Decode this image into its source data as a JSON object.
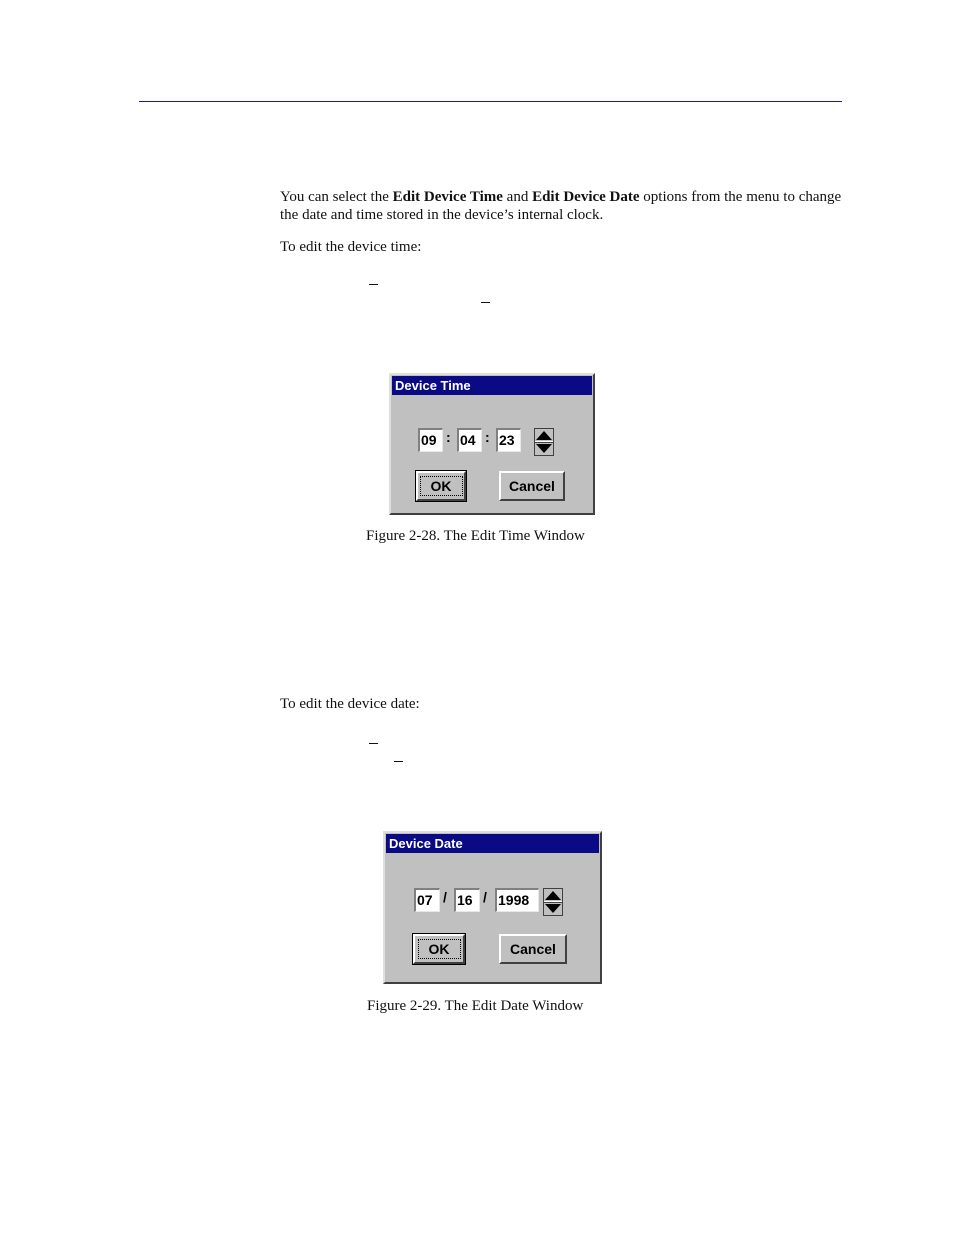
{
  "intro": {
    "text_before": "You can select the ",
    "bold_1": "Edit Device Time",
    "text_mid": " and ",
    "bold_2": "Edit Device Date",
    "text_after": " options from the menu to change the date and time stored in the device’s internal clock."
  },
  "time_steps_intro": "To edit the device time:",
  "date_steps_intro": "To edit the device date:",
  "time_dialog": {
    "title": "Device Time",
    "hours": "09",
    "minutes": "04",
    "seconds": "23",
    "separator": ":",
    "ok_label": "OK",
    "cancel_label": "Cancel",
    "caption": "Figure 2-28.  The Edit Time Window"
  },
  "date_dialog": {
    "title": "Device Date",
    "month": "07",
    "day": "16",
    "year": "1998",
    "separator": "/",
    "ok_label": "OK",
    "cancel_label": "Cancel",
    "caption": "Figure 2-29.  The Edit Date Window"
  },
  "colors": {
    "header_rule": "#1a1aa8",
    "titlebar": "#0a0a84",
    "dialog_face": "#c0c0c0"
  }
}
